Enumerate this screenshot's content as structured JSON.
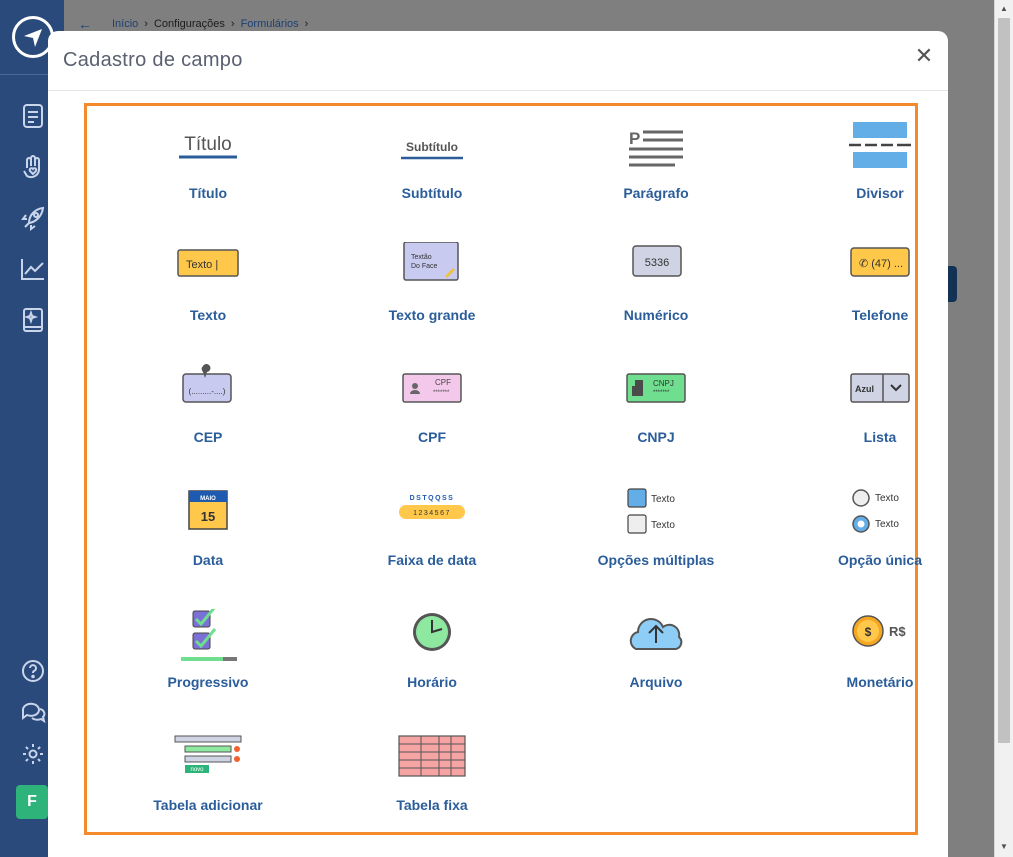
{
  "breadcrumb": {
    "items": [
      "Início",
      "Configurações",
      "Formulários"
    ]
  },
  "modal": {
    "title": "Cadastro de campo",
    "close_icon": "close-icon"
  },
  "sidebar": {
    "avatar_initial": "F",
    "icons": [
      "document-icon",
      "hand-heart-icon",
      "rocket-icon",
      "chart-icon",
      "book-sparkle-icon",
      "help-icon",
      "chat-icon",
      "gear-icon"
    ]
  },
  "fields": [
    {
      "label": "Título",
      "icon": "titulo",
      "icon_text": "Título"
    },
    {
      "label": "Subtítulo",
      "icon": "subtitulo",
      "icon_text": "Subtítulo"
    },
    {
      "label": "Parágrafo",
      "icon": "paragrafo",
      "icon_text": "P"
    },
    {
      "label": "Divisor",
      "icon": "divisor"
    },
    {
      "label": "Texto",
      "icon": "texto",
      "icon_text": "Texto |"
    },
    {
      "label": "Texto grande",
      "icon": "texto-grande",
      "icon_text": "Textão Do Face"
    },
    {
      "label": "Numérico",
      "icon": "numerico",
      "icon_text": "5336"
    },
    {
      "label": "Telefone",
      "icon": "telefone",
      "icon_text": "(47) ..."
    },
    {
      "label": "CEP",
      "icon": "cep",
      "icon_text": "(.........-....)"
    },
    {
      "label": "CPF",
      "icon": "cpf",
      "icon_text": "CPF"
    },
    {
      "label": "CNPJ",
      "icon": "cnpj",
      "icon_text": "CNPJ"
    },
    {
      "label": "Lista",
      "icon": "lista",
      "icon_text": "Azul"
    },
    {
      "label": "Data",
      "icon": "data",
      "icon_text": "MAIO",
      "icon_text2": "15"
    },
    {
      "label": "Faixa de data",
      "icon": "faixa-data",
      "icon_text": "DSTQQSS",
      "icon_text2": "1234567"
    },
    {
      "label": "Opções múltiplas",
      "icon": "opcoes-multiplas",
      "icon_text": "Texto",
      "icon_text2": "Texto"
    },
    {
      "label": "Opção única",
      "icon": "opcao-unica",
      "icon_text": "Texto",
      "icon_text2": "Texto"
    },
    {
      "label": "Progressivo",
      "icon": "progressivo"
    },
    {
      "label": "Horário",
      "icon": "horario"
    },
    {
      "label": "Arquivo",
      "icon": "arquivo"
    },
    {
      "label": "Monetário",
      "icon": "monetario",
      "icon_text": "R$",
      "icon_text2": "$"
    },
    {
      "label": "Tabela adicionar",
      "icon": "tabela-adicionar",
      "icon_text": "novo"
    },
    {
      "label": "Tabela fixa",
      "icon": "tabela-fixa"
    }
  ],
  "colors": {
    "accent_orange": "#f58a2c",
    "label_blue": "#2a5d9a",
    "sidebar_bg": "#2b4a7c",
    "avatar_green": "#2eb47a"
  }
}
